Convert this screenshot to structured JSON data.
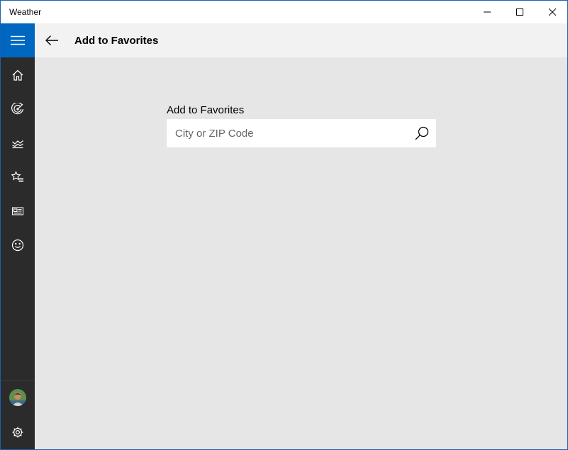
{
  "window": {
    "title": "Weather",
    "controls": [
      "minimize-icon",
      "maximize-icon",
      "close-icon"
    ]
  },
  "sidebar": {
    "menu_icon": "hamburger-menu-icon",
    "items": [
      {
        "icon": "home-icon"
      },
      {
        "icon": "radar-icon"
      },
      {
        "icon": "historical-weather-icon"
      },
      {
        "icon": "favorites-icon"
      },
      {
        "icon": "news-icon"
      },
      {
        "icon": "feedback-smiley-icon"
      }
    ],
    "footer": [
      {
        "icon": "user-avatar"
      },
      {
        "icon": "settings-gear-icon"
      }
    ]
  },
  "header": {
    "back_icon": "back-arrow-icon",
    "title": "Add to Favorites"
  },
  "main": {
    "field_label": "Add to Favorites",
    "search_placeholder": "City or ZIP Code",
    "search_value": "",
    "search_icon": "search-icon"
  },
  "colors": {
    "accent": "#0067c0",
    "sidebar_bg": "#2b2b2b",
    "header_bg": "#f2f2f2",
    "content_bg": "#e6e6e6"
  }
}
